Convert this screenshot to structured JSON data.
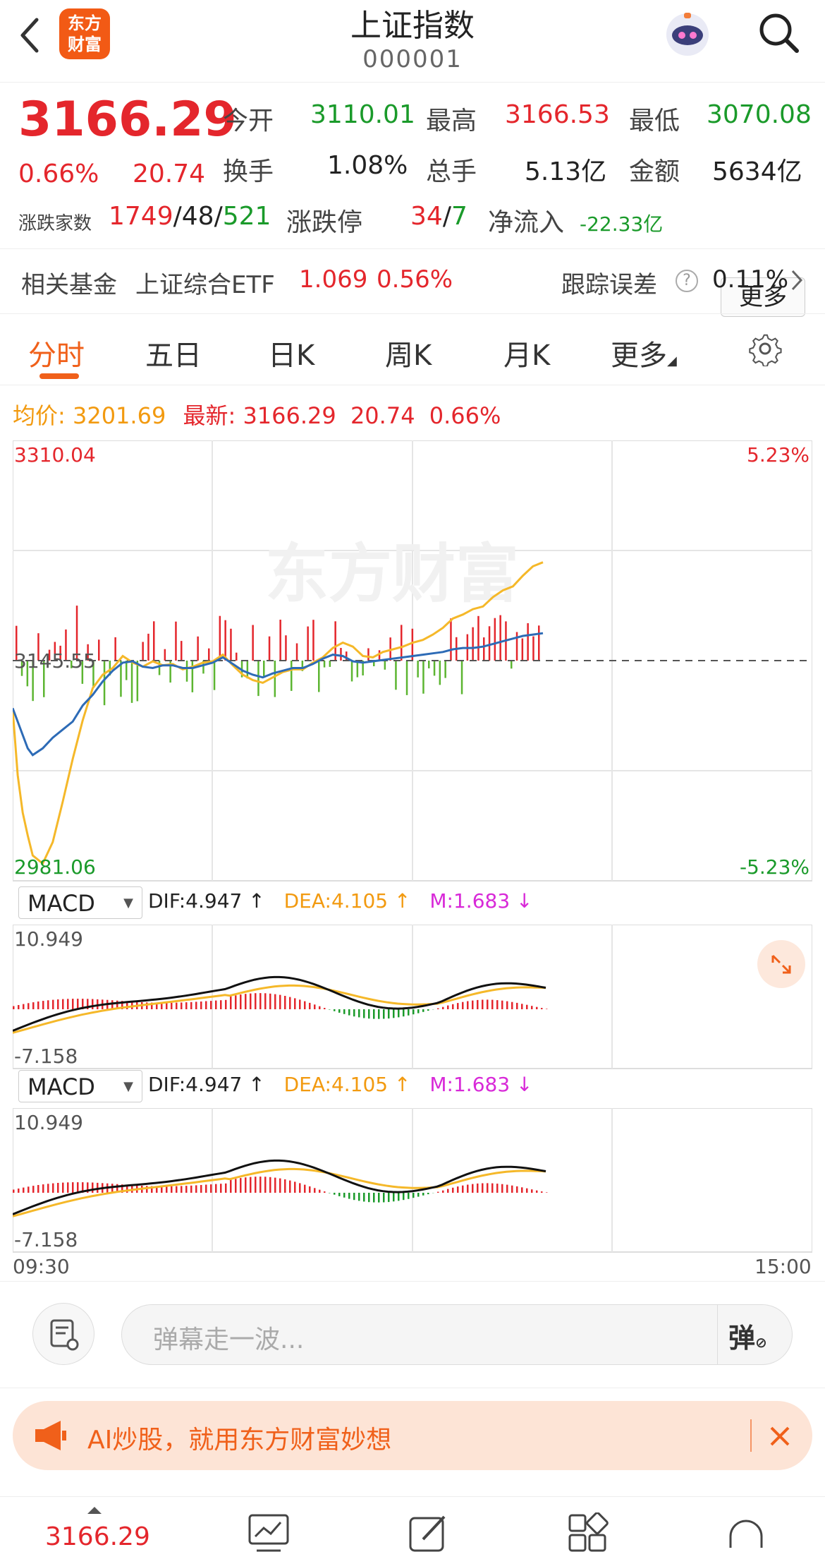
{
  "header": {
    "title": "上证指数",
    "code": "000001",
    "logo_text": "东方财富",
    "icons": [
      "back-arrow-icon",
      "robot-avatar-icon",
      "search-icon"
    ]
  },
  "quote": {
    "price": "3166.29",
    "change_pct": "0.66%",
    "change_amt": "20.74",
    "open_label": "今开",
    "open": "3110.01",
    "high_label": "最高",
    "high": "3166.53",
    "low_label": "最低",
    "low": "3070.08",
    "turnover_label": "换手",
    "turnover": "1.08%",
    "volume_label": "总手",
    "volume": "5.13亿",
    "amount_label": "金额",
    "amount": "5634亿",
    "breadth_label": "涨跌家数",
    "breadth_up": "1749",
    "breadth_flat": "48",
    "breadth_down": "521",
    "limit_label": "涨跌停",
    "limit_up": "34",
    "limit_down": "7",
    "netflow_label": "净流入",
    "netflow": "-22.33亿",
    "more_button": "更多",
    "fund_label": "相关基金",
    "fund_name": "上证综合ETF",
    "fund_price": "1.069",
    "fund_pct": "0.56%",
    "tracking_label": "跟踪误差",
    "tracking_value": "0.11%"
  },
  "tabs": [
    "分时",
    "五日",
    "日K",
    "周K",
    "月K",
    "更多"
  ],
  "active_tab": "分时",
  "info_line": {
    "avg_label": "均价:",
    "avg": "3201.69",
    "latest_label": "最新:",
    "latest": "3166.29",
    "latest_chg": "20.74",
    "latest_pct": "0.66%"
  },
  "main_chart": {
    "ymax": "3310.04",
    "ymax_pct": "5.23%",
    "ymid": "3145.55",
    "ymin": "2981.06",
    "ymin_pct": "-5.23%",
    "watermark": "东方财富",
    "x_start": "09:30",
    "x_end": "15:00"
  },
  "chart_data": {
    "type": "line",
    "ylim": [
      2981.06,
      3310.04
    ],
    "prev_close": 3145.55,
    "x": [
      0,
      5,
      10,
      15,
      20,
      30,
      40,
      50,
      60,
      70,
      80,
      90,
      100,
      110,
      120,
      130,
      140,
      150,
      160,
      170,
      180,
      190,
      200,
      210,
      220,
      230,
      240,
      250,
      260,
      270,
      280,
      290,
      300,
      310,
      320,
      330,
      340,
      350,
      360,
      370,
      380,
      390,
      400,
      410,
      420,
      430,
      440,
      450,
      460,
      470,
      480,
      490,
      500,
      510,
      520,
      530
    ],
    "series": [
      {
        "name": "price",
        "color": "#f5b829",
        "values": [
          3109,
          3060,
          3032,
          3015,
          3000,
          2994,
          3010,
          3040,
          3072,
          3101,
          3125,
          3135,
          3140,
          3149,
          3144,
          3141,
          3145,
          3142,
          3143,
          3139,
          3141,
          3144,
          3145,
          3150,
          3142,
          3135,
          3131,
          3129,
          3133,
          3137,
          3139,
          3139,
          3144,
          3148,
          3155,
          3159,
          3156,
          3149,
          3148,
          3152,
          3154,
          3156,
          3159,
          3161,
          3165,
          3170,
          3177,
          3180,
          3184,
          3186,
          3193,
          3198,
          3201,
          3209,
          3216,
          3219
        ]
      },
      {
        "name": "avg",
        "color": "#2d6bb6",
        "values": [
          3110,
          3100,
          3090,
          3080,
          3075,
          3080,
          3088,
          3094,
          3100,
          3112,
          3120,
          3130,
          3138,
          3144,
          3145,
          3141,
          3140,
          3142,
          3142,
          3140,
          3140,
          3142,
          3144,
          3148,
          3143,
          3138,
          3135,
          3133,
          3136,
          3138,
          3140,
          3140,
          3143,
          3147,
          3150,
          3149,
          3145,
          3144,
          3145,
          3146,
          3147,
          3148,
          3149,
          3150,
          3151,
          3152,
          3154,
          3155,
          3155,
          3156,
          3158,
          3160,
          3162,
          3164,
          3165,
          3166
        ]
      }
    ]
  },
  "macd": {
    "selector": "MACD",
    "dif": "DIF:4.947 ↑",
    "dea": "DEA:4.105 ↑",
    "m": "M:1.683 ↓",
    "ymax": "10.949",
    "ymin": "-7.158"
  },
  "danmu": {
    "placeholder": "弹幕走一波...",
    "send_label": "弹"
  },
  "ai_banner": {
    "text": "AI炒股，就用东方财富妙想"
  },
  "bottom_nav": {
    "price": "3166.29",
    "icons": [
      "trend-chart-icon",
      "edit-icon",
      "apps-icon",
      "headset-icon"
    ]
  },
  "colors": {
    "up": "#e4262c",
    "down": "#1a9a2a",
    "accent": "#f0601a",
    "avg_line": "#f5b829",
    "price_line": "#2d6bb6"
  }
}
